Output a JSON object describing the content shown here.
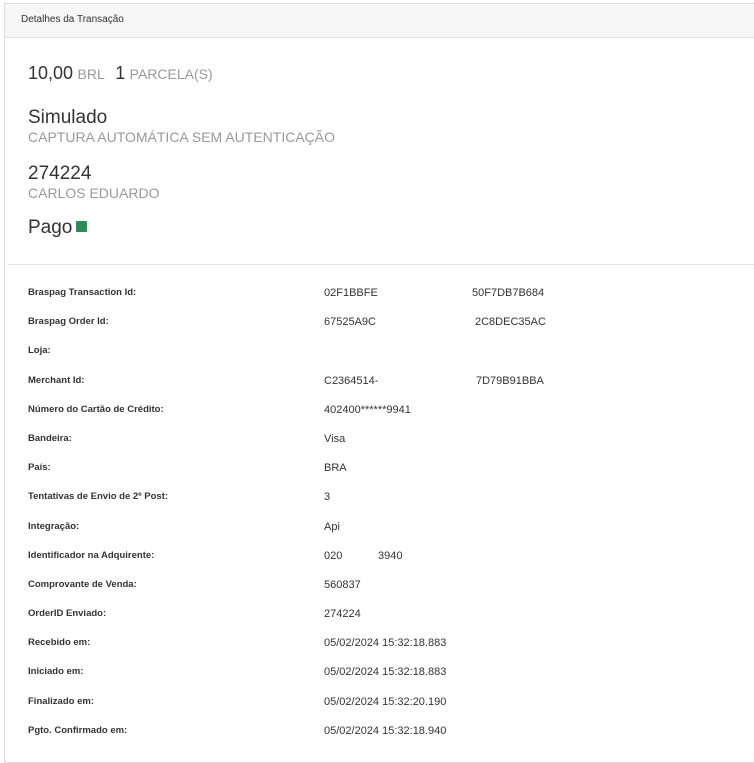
{
  "header": {
    "title": "Detalhes da Transação"
  },
  "summary": {
    "amount": "10,00",
    "currency": "BRL",
    "installments": "1",
    "installments_label": "PARCELA(S)",
    "provider": "Simulado",
    "capture_mode": "CAPTURA AUTOMÁTICA SEM AUTENTICAÇÃO",
    "order_number": "274224",
    "customer_name": "CARLOS EDUARDO",
    "status": "Pago",
    "status_color": "#2e8b57"
  },
  "details": [
    {
      "label": "Braspag Transaction Id:",
      "value": "02F1BBFE",
      "value_tail": "50F7DB7B684"
    },
    {
      "label": "Braspag Order Id:",
      "value": "67525A9C",
      "value_tail": "2C8DEC35AC"
    },
    {
      "label": "Loja:",
      "value": ""
    },
    {
      "label": "Merchant Id:",
      "value": "C2364514-",
      "value_tail": "7D79B91BBA"
    },
    {
      "label": "Número do Cartão de Crédito:",
      "value": "402400******9941"
    },
    {
      "label": "Bandeira:",
      "value": "Visa"
    },
    {
      "label": "País:",
      "value": "BRA"
    },
    {
      "label": "Tentativas de Envio de 2º Post:",
      "value": "3"
    },
    {
      "label": "Integração:",
      "value": "Api"
    },
    {
      "label": "Identificador na Adquirente:",
      "value": "020",
      "value_tail": "3940"
    },
    {
      "label": "Comprovante de Venda:",
      "value": "560837"
    },
    {
      "label": "OrderID Enviado:",
      "value": "274224"
    },
    {
      "label": "Recebido em:",
      "value": "05/02/2024 15:32:18.883"
    },
    {
      "label": "Iniciado em:",
      "value": "05/02/2024 15:32:18.883"
    },
    {
      "label": "Finalizado em:",
      "value": "05/02/2024 15:32:20.190"
    },
    {
      "label": "Pgto. Confirmado em:",
      "value": "05/02/2024 15:32:18.940"
    }
  ]
}
